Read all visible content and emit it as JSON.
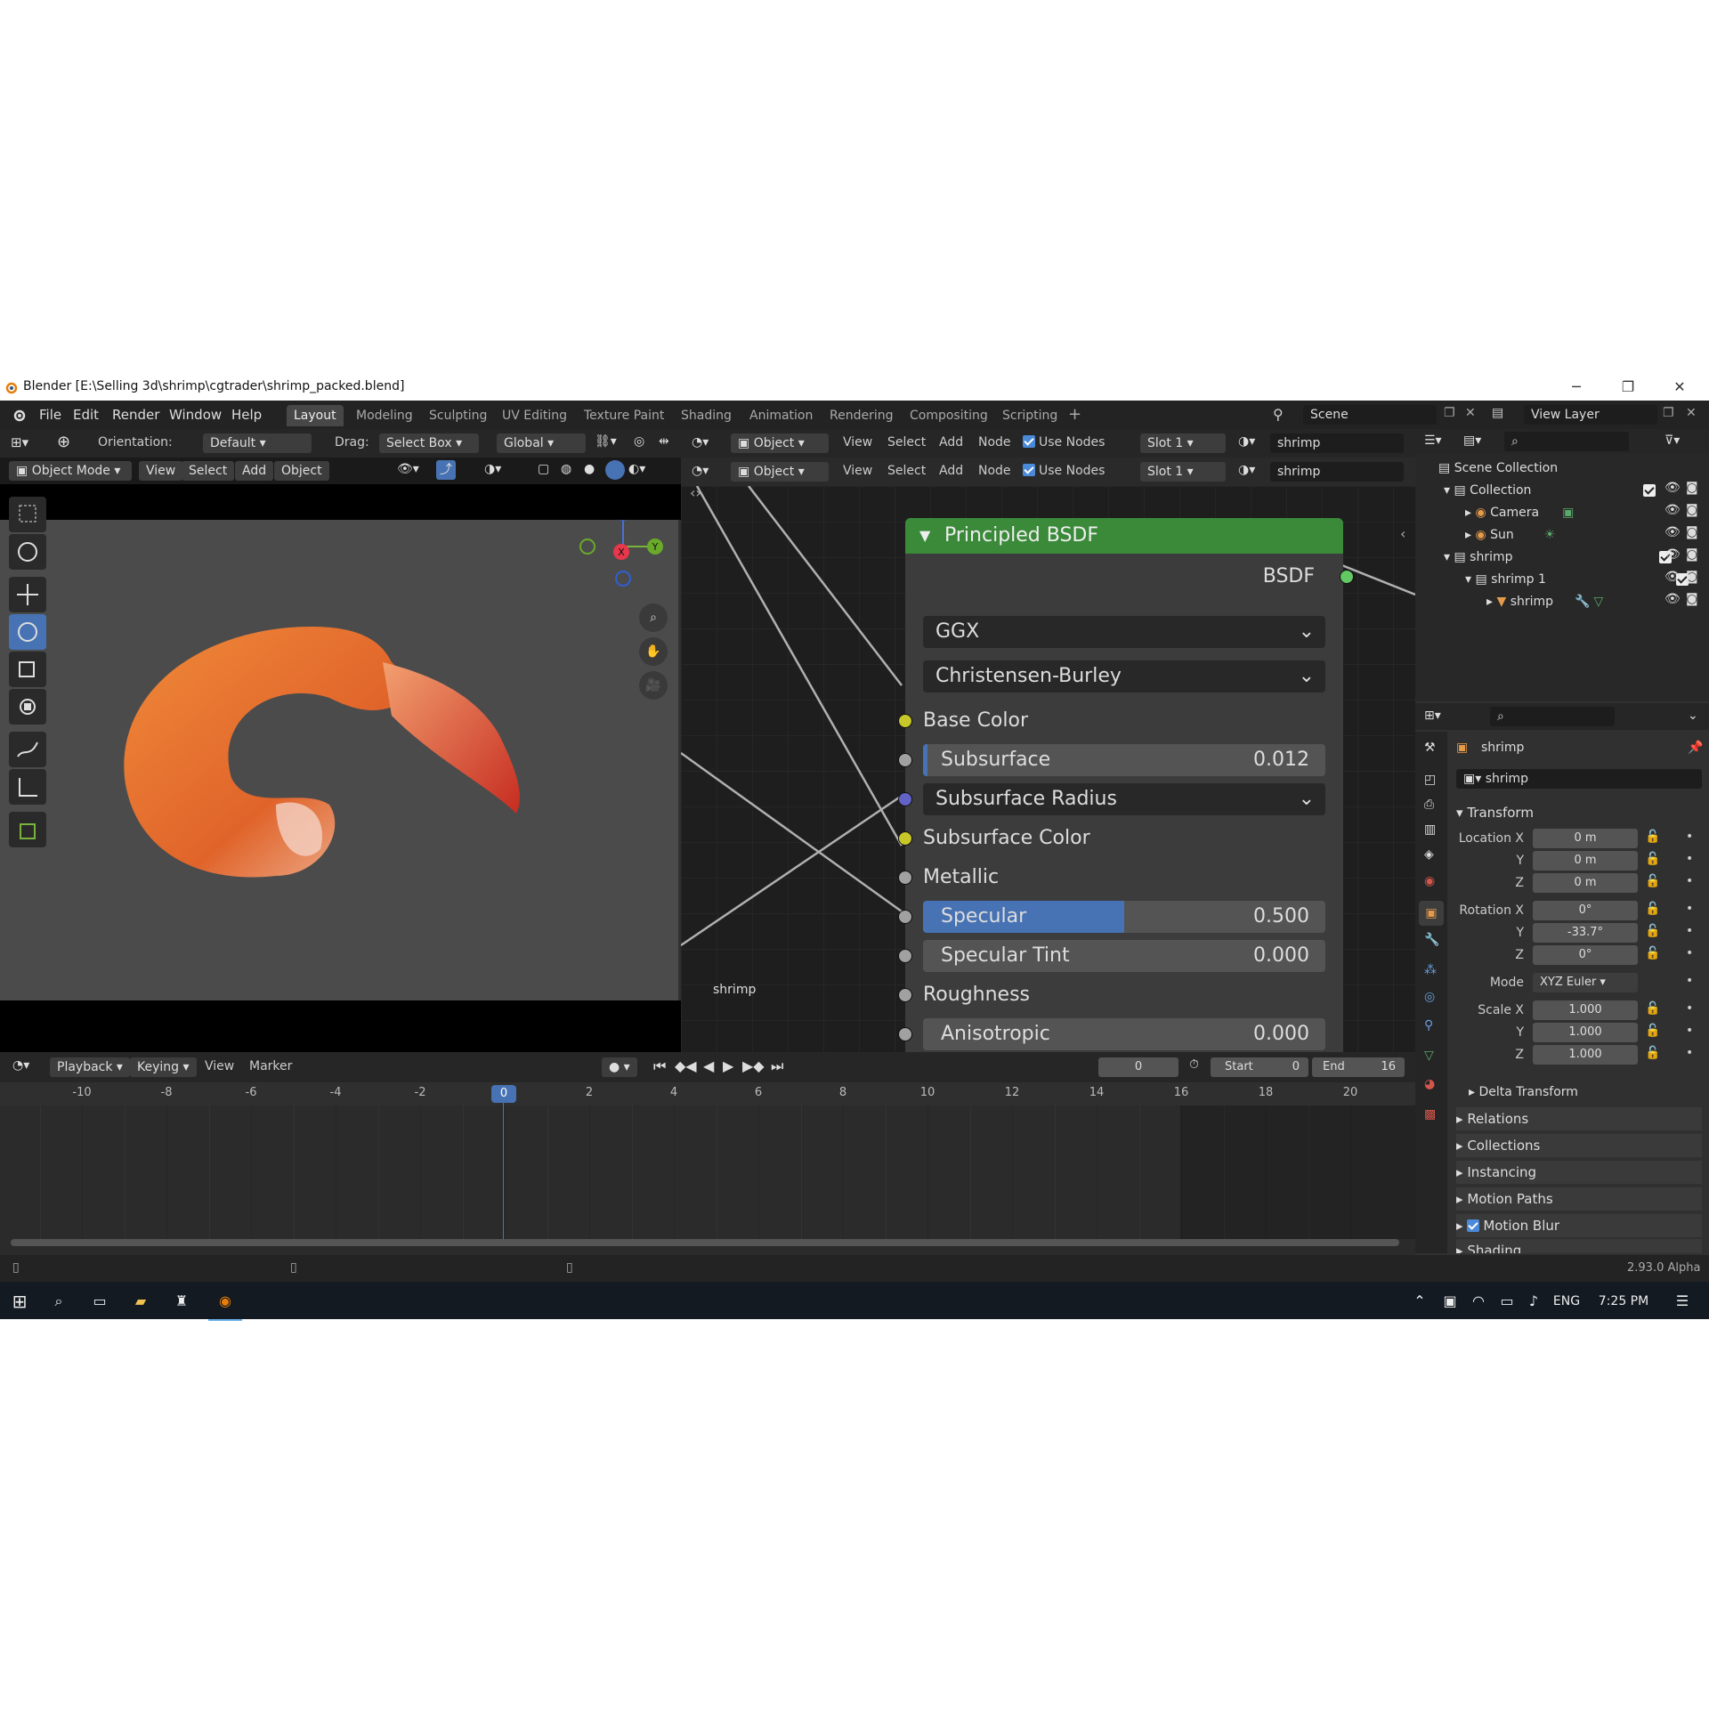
{
  "window": {
    "title": "Blender [E:\\Selling 3d\\shrimp\\cgtrader\\shrimp_packed.blend]"
  },
  "menu": {
    "items": [
      "File",
      "Edit",
      "Render",
      "Window",
      "Help"
    ]
  },
  "workspaces": {
    "tabs": [
      "Layout",
      "Modeling",
      "Sculpting",
      "UV Editing",
      "Texture Paint",
      "Shading",
      "Animation",
      "Rendering",
      "Compositing",
      "Scripting"
    ],
    "active": "Layout"
  },
  "scene": {
    "label": "Scene",
    "view_layer": "View Layer"
  },
  "viewport_header": {
    "orientation_label": "Orientation:",
    "orientation_value": "Default",
    "drag_label": "Drag:",
    "drag_value": "Select Box",
    "transform_space": "Global",
    "mode": "Object Mode",
    "menus": [
      "View",
      "Select",
      "Add",
      "Object"
    ]
  },
  "viewport": {
    "gizmo": {
      "z": "Z",
      "x": "X",
      "y": "Y"
    },
    "object_name_overlay": "shrimp"
  },
  "node_editor": {
    "header1": {
      "type": "Object",
      "menus": [
        "View",
        "Select",
        "Add",
        "Node"
      ],
      "use_nodes": "Use Nodes",
      "slot": "Slot 1",
      "material": "shrimp"
    },
    "header2": {
      "type": "Object",
      "menus": [
        "View",
        "Select",
        "Add",
        "Node"
      ],
      "use_nodes": "Use Nodes",
      "slot": "Slot 1",
      "material": "shrimp"
    },
    "node": {
      "title": "Principled BSDF",
      "output": "BSDF",
      "distribution": "GGX",
      "subsurface_method": "Christensen-Burley",
      "inputs": {
        "base_color": "Base Color",
        "subsurface_label": "Subsurface",
        "subsurface_value": "0.012",
        "subsurface_radius": "Subsurface Radius",
        "subsurface_color": "Subsurface Color",
        "metallic": "Metallic",
        "specular_label": "Specular",
        "specular_value": "0.500",
        "specular_tint_label": "Specular Tint",
        "specular_tint_value": "0.000",
        "roughness": "Roughness",
        "anisotropic_label": "Anisotropic",
        "anisotropic_value": "0.000"
      },
      "specular_fill": 0.5,
      "subsurface_fill": 0.012
    }
  },
  "outliner": {
    "rows": [
      {
        "label": "Scene Collection",
        "indent": 0
      },
      {
        "label": "Collection",
        "indent": 1
      },
      {
        "label": "Camera",
        "indent": 2
      },
      {
        "label": "Sun",
        "indent": 2
      },
      {
        "label": "shrimp",
        "indent": 1
      },
      {
        "label": "shrimp 1",
        "indent": 2
      },
      {
        "label": "shrimp",
        "indent": 3
      }
    ]
  },
  "properties": {
    "object_name": "shrimp",
    "data_name": "shrimp",
    "transform_header": "Transform",
    "location": {
      "label": "Location X",
      "x": "0 m",
      "y": "0 m",
      "z": "0 m"
    },
    "rotation": {
      "label": "Rotation X",
      "x": "0°",
      "y": "-33.7°",
      "z": "0°"
    },
    "mode_label": "Mode",
    "mode_value": "XYZ Euler",
    "scale": {
      "label": "Scale X",
      "x": "1.000",
      "y": "1.000",
      "z": "1.000"
    },
    "axis_y": "Y",
    "axis_z": "Z",
    "sections": [
      "Delta Transform",
      "Relations",
      "Collections",
      "Instancing",
      "Motion Paths",
      "Motion Blur",
      "Shading"
    ]
  },
  "timeline": {
    "menus": [
      "Playback",
      "Keying",
      "View",
      "Marker"
    ],
    "current_frame": "0",
    "start_label": "Start",
    "start_value": "0",
    "end_label": "End",
    "end_value": "16",
    "ruler": [
      "-10",
      "-8",
      "-6",
      "-4",
      "-2",
      "0",
      "2",
      "4",
      "6",
      "8",
      "10",
      "12",
      "14",
      "16",
      "18",
      "20"
    ]
  },
  "status": {
    "version": "2.93.0 Alpha"
  },
  "taskbar": {
    "lang": "ENG",
    "time": "7:25 PM"
  },
  "colors": {
    "accent": "#4772b3",
    "node_header": "#3a8a3a",
    "socket_yellow": "#c7c729",
    "socket_gray": "#a1a1a1",
    "socket_blue": "#6363c7",
    "socket_green": "#63c763"
  }
}
